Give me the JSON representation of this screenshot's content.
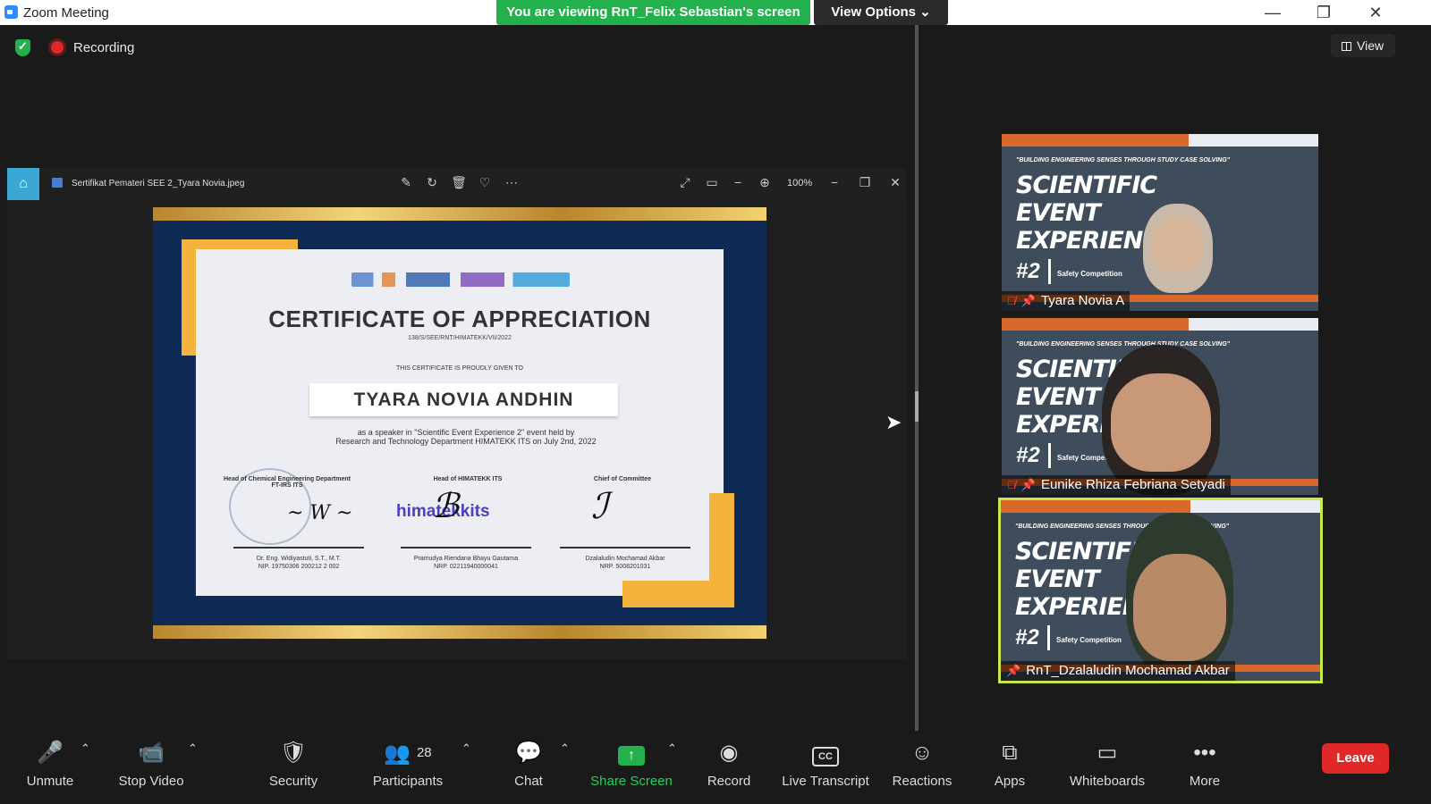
{
  "window": {
    "title": "Zoom Meeting",
    "share_banner": "You are viewing RnT_Felix Sebastian's screen",
    "view_options": "View Options ⌄",
    "minimize": "—",
    "maximize": "❐",
    "close": "✕"
  },
  "status": {
    "recording_label": "Recording"
  },
  "viewer": {
    "file_name": "Sertifikat Pemateri SEE 2_Tyara Novia.jpeg",
    "zoom_level": "100%"
  },
  "certificate": {
    "title": "CERTIFICATE OF APPRECIATION",
    "number": "138/S/SEE/RNT/HIMATEKK/VII/2022",
    "given_to_label": "THIS CERTIFICATE IS PROUDLY GIVEN TO",
    "recipient": "TYARA NOVIA ANDHIN",
    "description_line1": "as a speaker in \"Scientific Event Experience 2\" event held by",
    "description_line2": "Research and Technology Department HIMATEKK ITS on July 2nd, 2022",
    "signatories": [
      {
        "title": "Head of Chemical Engineering Department FT-IRS ITS",
        "name": "Dr. Eng. Widiyastuti, S.T., M.T.",
        "id": "NIP. 19750306 200212 2 002"
      },
      {
        "title": "Head of HIMATEKK ITS",
        "name": "Pramudya Riendana Bhayu Gautama",
        "id": "NRP. 02211940000041"
      },
      {
        "title": "Chief of Committee",
        "name": "Dzalaludin Mochamad Akbar",
        "id": "NRP. 5008201031"
      }
    ],
    "himatekk_logo": "himatekkits"
  },
  "right_panel": {
    "view_label": "View"
  },
  "participants_tiles": [
    {
      "name": "Tyara Novia A",
      "muted": true,
      "pinned": true
    },
    {
      "name": "Eunike Rhiza Febriana Setyadi",
      "muted": true,
      "pinned": true
    },
    {
      "name": "RnT_Dzalaludin Mochamad Akbar",
      "muted": false,
      "pinned": true
    }
  ],
  "tile_background": {
    "slogan": "\"BUILDING ENGINEERING SENSES THROUGH STUDY CASE SOLVING\"",
    "line1": "SCIENTIFIC",
    "line2": "EVENT",
    "line3": "EXPERIENCE",
    "number": "#2",
    "sub": "Safety Competition"
  },
  "toolbar": {
    "unmute": "Unmute",
    "stop_video": "Stop Video",
    "security": "Security",
    "participants": "Participants",
    "participants_count": "28",
    "chat": "Chat",
    "share_screen": "Share Screen",
    "record": "Record",
    "live_transcript": "Live Transcript",
    "reactions": "Reactions",
    "apps": "Apps",
    "whiteboards": "Whiteboards",
    "more": "More",
    "leave": "Leave"
  },
  "colors": {
    "share_green": "#23b14d",
    "leave_red": "#e02828",
    "active_speaker_border": "#c9e84a"
  }
}
